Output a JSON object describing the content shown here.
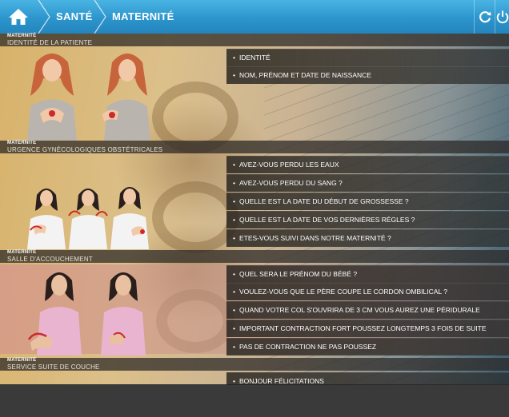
{
  "header": {
    "breadcrumb": [
      "SANTÉ",
      "MATERNITÉ"
    ]
  },
  "sections": [
    {
      "category": "MATERNITÉ",
      "title": "IDENTITÉ DE LA PATIENTE",
      "items": [
        "IDENTITÉ",
        "NOM, PRÉNOM ET DATE DE NAISSANCE"
      ]
    },
    {
      "category": "MATERNITÉ",
      "title": "URGENCE GYNÉCOLOGIQUES OBSTÉTRICALES",
      "items": [
        "AVEZ-VOUS PERDU LES EAUX",
        "AVEZ-VOUS PERDU DU SANG ?",
        "QUELLE EST LA DATE DU DÉBUT DE GROSSESSE ?",
        "QUELLE EST LA DATE DE VOS DERNIÈRES RÉGLES ?",
        "ETES-VOUS SUIVI DANS NOTRE MATERNITÉ ?"
      ]
    },
    {
      "category": "MATERNITÉ",
      "title": "SALLE D'ACCOUCHEMENT",
      "items": [
        "QUEL SERA LE PRÉNOM DU BÉBÉ ?",
        "VOULEZ-VOUS QUE LE PÈRE COUPE LE CORDON OMBILICAL ?",
        "QUAND VOTRE COL S'OUVRIRA DE 3 CM VOUS AUREZ UNE PÉRIDURALE",
        "IMPORTANT CONTRACTION FORT POUSSEZ LONGTEMPS 3 FOIS DE SUITE",
        "PAS DE CONTRACTION NE PAS POUSSEZ"
      ]
    },
    {
      "category": "MATERNITÉ",
      "title": "SERVICE SUITE DE COUCHE",
      "items": [
        "BONJOUR FÉLICITATIONS"
      ]
    }
  ],
  "bullet": "•",
  "icons": {
    "home": "home-icon",
    "refresh": "refresh-icon",
    "power": "power-icon"
  },
  "colors": {
    "topbar": "#2c95cc",
    "section_bg": "#2a2624",
    "item_bg": "#23211e"
  }
}
